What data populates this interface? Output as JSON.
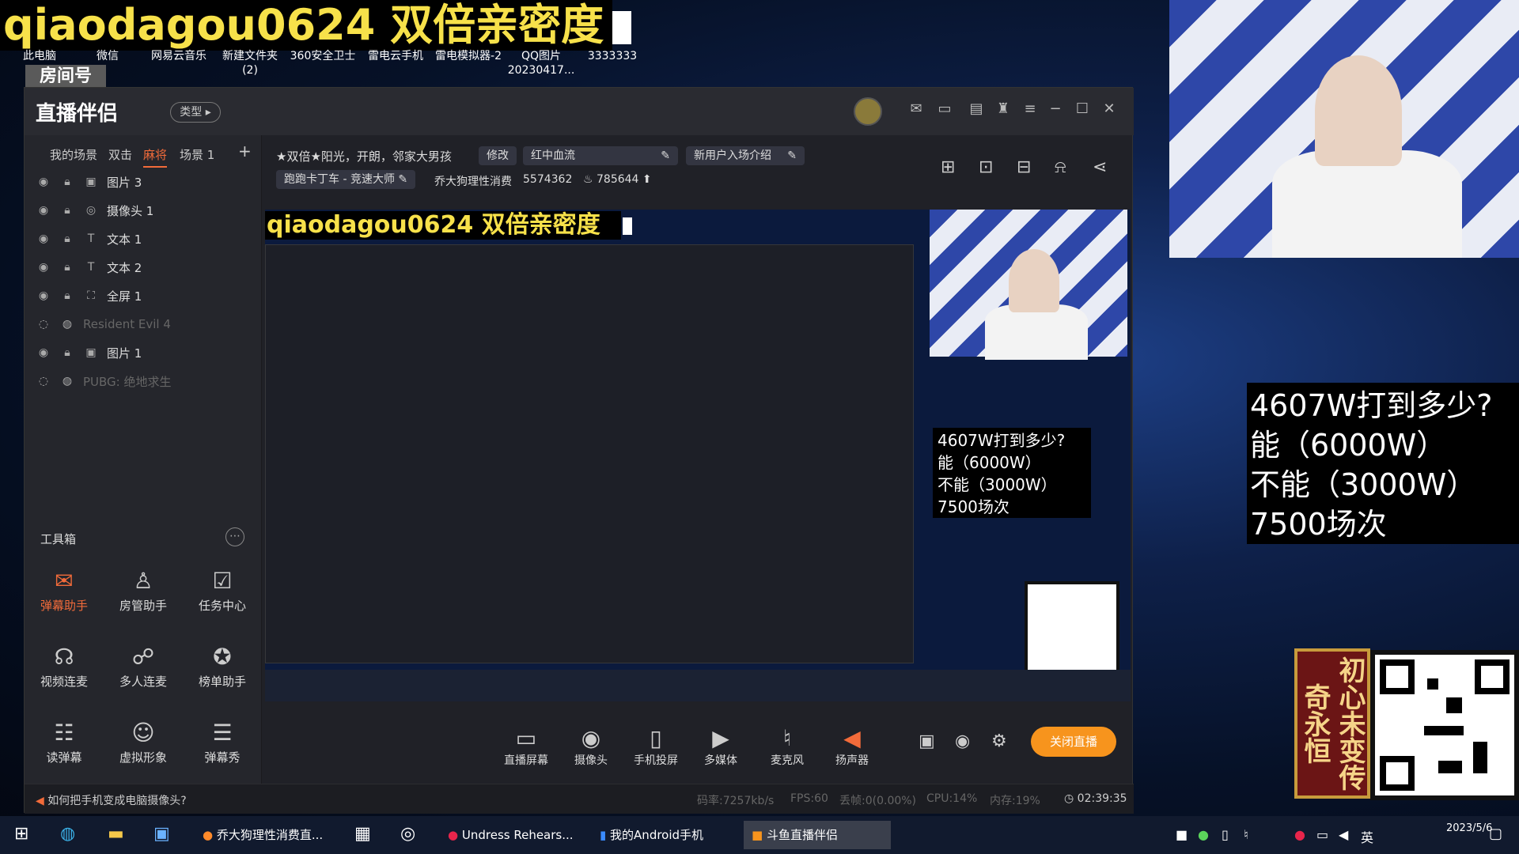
{
  "desktop": {
    "banner": "qiaodagou0624 双倍亲密度",
    "icons": [
      "此电脑",
      "微信",
      "网易云音乐",
      "新建文件夹\n(2)",
      "360安全卫士",
      "雷电云手机",
      "雷电模拟器-2",
      "QQ图片\n20230417...",
      "3333333"
    ],
    "room_badge": "房间号",
    "room_id": "5574362"
  },
  "app": {
    "logo": "直播伴侣",
    "type_btn": "类型",
    "scene_tabs": [
      "我的场景",
      "双击",
      "麻将",
      "场景 1"
    ],
    "layers": [
      {
        "label": "图片 3",
        "on": true
      },
      {
        "label": "摄像头 1",
        "on": true
      },
      {
        "label": "文本 1",
        "on": true
      },
      {
        "label": "文本 2",
        "on": true
      },
      {
        "label": "全屏 1",
        "on": true
      },
      {
        "label": "Resident Evil 4",
        "on": false
      },
      {
        "label": "图片 1",
        "on": true
      },
      {
        "label": "PUBG: 绝地求生",
        "on": false
      }
    ],
    "toolbox_title": "工具箱",
    "tools": [
      "弹幕助手",
      "房管助手",
      "任务中心",
      "视频连麦",
      "多人连麦",
      "榜单助手",
      "读弹幕",
      "虚拟形象",
      "弹幕秀"
    ],
    "stream_title": "★双倍★阳光，开朗，邻家大男孩",
    "edit": "修改",
    "theme": "红中血流",
    "new_user": "新用户入场介绍",
    "category": "跑跑卡丁车 - 竞速大师",
    "streamer": "乔大狗理性消费",
    "room_no": "5574362",
    "heat": "785644",
    "preview_overlay": "4607W打到多少?\n能（6000W）\n不能（3000W）\n7500场次",
    "bottom_controls": [
      "直播屏幕",
      "摄像头",
      "手机投屏",
      "多媒体",
      "麦克风",
      "扬声器"
    ],
    "live_button": "关闭直播",
    "tip": "如何把手机变成电脑摄像头?",
    "stats": {
      "bitrate": "码率:7257kb/s",
      "fps": "FPS:60",
      "drop": "丢帧:0(0.00%)",
      "cpu": "CPU:14%",
      "mem": "内存:19%",
      "time": "02:39:35"
    }
  },
  "overlay": {
    "big_text": "4607W打到多少?\n能（6000W）\n不能（3000W）\n7500场次",
    "qr_badge": "初心未变传奇永恒"
  },
  "taskbar": {
    "apps": [
      "乔大狗理性消费直...",
      "Undress Rehears...",
      "我的Android手机",
      "斗鱼直播伴侣"
    ],
    "ime": "英",
    "date": "2023/5/6"
  },
  "colors": {
    "accent": "#f26b3a",
    "live": "#f7941d",
    "banner": "#f7e14a"
  }
}
